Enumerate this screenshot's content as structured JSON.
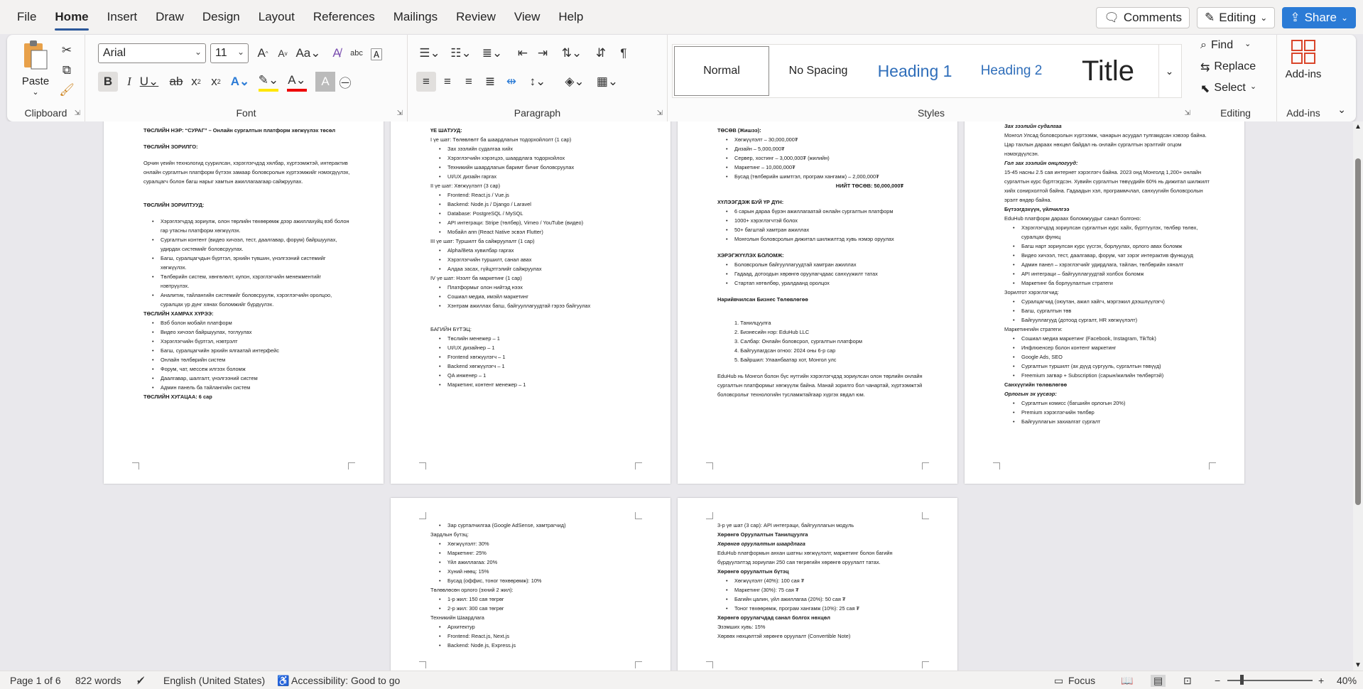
{
  "menu": {
    "tabs": [
      "File",
      "Home",
      "Insert",
      "Draw",
      "Design",
      "Layout",
      "References",
      "Mailings",
      "Review",
      "View",
      "Help"
    ],
    "comments": "Comments",
    "editing": "Editing",
    "share": "Share"
  },
  "ribbon": {
    "clipboard": {
      "paste": "Paste",
      "label": "Clipboard"
    },
    "font": {
      "name": "Arial",
      "size": "11",
      "label": "Font"
    },
    "paragraph": {
      "label": "Paragraph"
    },
    "styles": {
      "label": "Styles",
      "items": [
        "Normal",
        "No Spacing",
        "Heading 1",
        "Heading 2",
        "Title"
      ]
    },
    "editing": {
      "find": "Find",
      "replace": "Replace",
      "select": "Select",
      "label": "Editing"
    },
    "addins": {
      "button": "Add-ins",
      "label": "Add-ins"
    }
  },
  "pages": {
    "p1": [
      [
        "b",
        "ТӨСЛИЙН НЭР: “СУРАГ” – Онлайн сургалтын платформ хөгжүүлэх төсөл"
      ],
      [
        "gap",
        ""
      ],
      [
        "b",
        "ТӨСЛИЙН ЗОРИЛГО:"
      ],
      [
        "gap",
        ""
      ],
      [
        "n",
        "Орчин үеийн технологид суурилсан, хэрэглэгчдэд хялбар, хүртээмжтэй, интерактив онлайн сургалтын платформ бүтээх замаар боловсролын хүртээмжийг нэмэгдүүлэх, суралцагч болон багш нарыг хамтын ажиллагаагаар сайжруулах."
      ],
      [
        "gap",
        ""
      ],
      [
        "gap",
        ""
      ],
      [
        "b",
        "ТӨСЛИЙН ЗОРИЛТУУД:"
      ],
      [
        "gap",
        ""
      ],
      [
        "li",
        "Хэрэглэгчдэд зориулж, олон төрлийн төхөөрөмж дээр ажиллахуйц вэб болон гар утасны платформ хөгжүүлэх."
      ],
      [
        "li",
        "Сургалтын контент (видео хичээл, тест, даалгавар, форум) байршуулах, удирдах системийг боловсруулах."
      ],
      [
        "li",
        "Багш, суралцагчдын бүртгэл, эрхийн түвшин, үнэлгээний системийг хөгжүүлэх."
      ],
      [
        "li",
        "Төлбөрийн систем, хөнгөлөлт, купон, хэрэглэгчийн менежментийг нэвтрүүлэх."
      ],
      [
        "li",
        "Аналитик, тайлангийн системийг боловсруулж, хэрэглэгчийн оролцоо, суралцах үр дүнг хянах боломжийг бүрдүүлэх."
      ],
      [
        "b",
        "ТӨСЛИЙН ХАМРАХ ХҮРЭЭ:"
      ],
      [
        "li",
        "Вэб болон мобайл платформ"
      ],
      [
        "li",
        "Видео хичээл байршуулах, тоглуулах"
      ],
      [
        "li",
        "Хэрэглэгчийн бүртгэл, нэвтрэлт"
      ],
      [
        "li",
        "Багш, суралцагчийн эрхийн ялгаатай интерфейс"
      ],
      [
        "li",
        "Онлайн төлбөрийн систем"
      ],
      [
        "li",
        "Форум, чат, мессеж илгээх боломж"
      ],
      [
        "li",
        "Даалгавар, шалгалт, үнэлгээний систем"
      ],
      [
        "li",
        "Админ панель ба тайлангийн систем"
      ],
      [
        "b",
        "ТӨСЛИЙН ХУГАЦАА: 6 сар"
      ]
    ],
    "p2": [
      [
        "b",
        "ҮЕ ШАТУУД:"
      ],
      [
        "n",
        "I үе шат: Төлөвлөлт ба шаардлагын тодорхойлолт (1 сар)"
      ],
      [
        "li",
        "Зах зээлийн судалгаа хийх"
      ],
      [
        "li",
        "Хэрэглэгчийн хэрэгцээ, шаардлага тодорхойлох"
      ],
      [
        "li",
        "Техникийн шаардлагын баримт бичиг боловсруулах"
      ],
      [
        "li",
        "UI/UX дизайн гаргах"
      ],
      [
        "n",
        "II үе шат: Хөгжүүлэлт (3 сар)"
      ],
      [
        "li",
        "Frontend: React.js / Vue.js"
      ],
      [
        "li",
        "Backend: Node.js / Django / Laravel"
      ],
      [
        "li",
        "Database: PostgreSQL / MySQL"
      ],
      [
        "li",
        "API интеграци: Stripe (төлбөр), Vimeo / YouTube (видео)"
      ],
      [
        "li",
        "Мобайл апп (React Native эсвэл Flutter)"
      ],
      [
        "n",
        "III үе шат: Туршилт ба сайжруулалт (1 сар)"
      ],
      [
        "li",
        "Alpha/Beta хувилбар гаргах"
      ],
      [
        "li",
        "Хэрэглэгчийн туршилт, санал авах"
      ],
      [
        "li",
        "Алдаа засах, гүйцэтгэлийг сайжруулах"
      ],
      [
        "n",
        "IV үе шат: Нээлт ба маркетинг (1 сар)"
      ],
      [
        "li",
        "Платформыг олон нийтэд нээх"
      ],
      [
        "li",
        "Сошиал медиа, имэйл маркетинг"
      ],
      [
        "li",
        "Хэнтрам ажиллах багш, байгууллагуудтай гэрээ байгуулах"
      ],
      [
        "gap",
        ""
      ],
      [
        "gap",
        ""
      ],
      [
        "n",
        "БАГИЙН БҮТЭЦ:"
      ],
      [
        "li",
        "Төслийн менежер – 1"
      ],
      [
        "li",
        "UI/UX дизайнер – 1"
      ],
      [
        "li",
        "Frontend хөгжүүлэгч – 1"
      ],
      [
        "li",
        "Backend хөгжүүлэгч – 1"
      ],
      [
        "li",
        "QA инженер – 1"
      ],
      [
        "li",
        "Маркетинг, контент менежер – 1"
      ]
    ],
    "p3": [
      [
        "b",
        "ТӨСӨВ (Жишээ):"
      ],
      [
        "li",
        "Хөгжүүлэлт – 30,000,000₮"
      ],
      [
        "li",
        "Дизайн – 5,000,000₮"
      ],
      [
        "li",
        "Сервер, хостинг – 3,000,000₮ (жилийн)"
      ],
      [
        "li",
        "Маркетинг – 10,000,000₮"
      ],
      [
        "li",
        "Бусад (төлбөрийн шимтгэл, програм хангамж) – 2,000,000₮"
      ],
      [
        "c",
        "НИЙТ ТӨСӨВ: 50,000,000₮"
      ],
      [
        "gap",
        ""
      ],
      [
        "b",
        "ХҮЛЭЭГДЭЖ БУЙ ҮР ДҮН:"
      ],
      [
        "li",
        "6 сарын дараа бүрэн ажиллагаатай онлайн сургалтын платформ"
      ],
      [
        "li",
        "1000+ хэрэглэгчтэй болох"
      ],
      [
        "li",
        "50+ багштай хамтран ажиллах"
      ],
      [
        "li",
        "Монголын боловсролын дижитал шилжилтэд хувь нэмэр оруулах"
      ],
      [
        "gap",
        ""
      ],
      [
        "b",
        "ХЭРЭГЖҮҮЛЭХ БОЛОМЖ:"
      ],
      [
        "li",
        "Боловсролын байгууллагуудтай хамтран ажиллах"
      ],
      [
        "li",
        "Гадаад, дотоодын хөрөнгө оруулагчдаас санхүүжилт татах"
      ],
      [
        "li",
        "Стартап хөтөлбөр, уралдаанд оролцох"
      ],
      [
        "gap",
        ""
      ],
      [
        "b",
        "Нарийвчилсан Бизнес Төлөвлөгөө"
      ],
      [
        "gap",
        ""
      ],
      [
        "gap",
        ""
      ],
      [
        "ol",
        "1.  Танилцуулга"
      ],
      [
        "ol",
        "2.  Бизнесийн нэр: EduHub LLC"
      ],
      [
        "ol",
        "3.  Салбар: Онлайн боловсрол, сургалтын платформ"
      ],
      [
        "ol",
        "4.  Байгуулагдсан огноо: 2024 оны 6-р сар"
      ],
      [
        "ol",
        "5.  Байршил: Улаанбаатар хот, Монгол улс"
      ],
      [
        "gap",
        ""
      ],
      [
        "n",
        "    EduHub нь Монгол болон бүс нутгийн хэрэглэгчдэд зориулсан олон төрлийн онлайн сургалтын платформыг хөгжүүлж байна. Манай зорилго бол чанартай, хүртээмжтэй боловсролыг технологийн тусламжтайгаар хүргэх явдал юм."
      ]
    ],
    "p4": [
      [
        "bi",
        "Зах зээлийн судалгаа"
      ],
      [
        "n",
        "Монгол Улсад боловсролын хүртээмж, чанарын асуудал тулгамдсан хэвээр байна. Цар тахлын дараах нөхцөл байдал нь онлайн сургалтын эрэлтийг огцом нэмэгдүүлсэн."
      ],
      [
        "bi",
        "Гол зах зээлийн онцлогууд:"
      ],
      [
        "n",
        "15-45 насны 2.5 сая интернет хэрэглэгч байна. 2023 онд Монголд 1,200+ онлайн сургалтын курс бүртгэгдсэн. Хувийн сургалтын төвүүдийн 60% нь дижитал шилжилт хийх сонирхолтой байна. Гадаадын хэл, программчлал, санхүүгийн боловсролын эрэлт өндөр байна."
      ],
      [
        "b",
        "Бүтээгдэхүүн, үйлчилгээ"
      ],
      [
        "n",
        "EduHub платформ дараах боломжуудыг санал болгоно:"
      ],
      [
        "li",
        "Хэрэглэгчдэд зориулсан сургалтын курс хайх, бүртгүүлэх, төлбөр төлөх, суралцах функц"
      ],
      [
        "li",
        "Багш нарт зориулсан курс үүсгэх, борлуулах, орлого авах боломж"
      ],
      [
        "li",
        "Видео хичээл, тест, даалгавар, форум, чат зэрэг интерактив функцууд"
      ],
      [
        "li",
        "Админ панел – хэрэглэгчийг удирдлага, тайлан, төлбөрийн хяналт"
      ],
      [
        "li",
        "API интеграци – байгууллагуудтай холбох боломж"
      ],
      [
        "li",
        "Маркетинг ба борлуулалтын стратеги"
      ],
      [
        "n",
        "Зорилтот хэрэглэгчид:"
      ],
      [
        "li",
        "Суралцагчид (оюутан, ажил хайгч, мэргэжил дээшлүүлэгч)"
      ],
      [
        "li",
        "Багш, сургалтын төв"
      ],
      [
        "li",
        "Байгууллагууд (дотоод сургалт, HR хөгжүүлэлт)"
      ],
      [
        "n",
        "Маркетингийн стратеги:"
      ],
      [
        "li",
        "Сошиал медиа маркетинг (Facebook, Instagram, TikTok)"
      ],
      [
        "li",
        "Инфлюенсер болон контент маркетинг"
      ],
      [
        "li",
        "Google Ads, SEO"
      ],
      [
        "li",
        "Сургалтын туршилт (ах дүүд сургууль, сургалтын төвүүд)"
      ],
      [
        "li",
        "Freemium загвар + Subscription (сарын/жилийн төлбөртэй)"
      ],
      [
        "b",
        "Санхүүгийн төлөвлөгөө"
      ],
      [
        "bi",
        "Орлогын эх үүсвэр:"
      ],
      [
        "li",
        "Сургалтын комисс (багшийн орлогын 20%)"
      ],
      [
        "li",
        "Premium хэрэглэгчийн төлбөр"
      ],
      [
        "li",
        "Байгууллагын захиалгат сургалт"
      ]
    ],
    "p5": [
      [
        "li",
        "Зар сурталчилгаа (Google AdSense, хамтрагчид)"
      ],
      [
        "n",
        "Зардлын бүтэц:"
      ],
      [
        "li",
        "Хөгжүүлэлт: 30%"
      ],
      [
        "li",
        "Маркетинг: 25%"
      ],
      [
        "li",
        "Үйл ажиллагаа: 20%"
      ],
      [
        "li",
        "Хүний нөөц: 15%"
      ],
      [
        "li",
        "Бусад (оффис, тоног төхөөрөмж): 10%"
      ],
      [
        "n",
        "Төлөвлөсөн орлого (эхний 2 жил):"
      ],
      [
        "li",
        "1-р жил: 150 сая төгрөг"
      ],
      [
        "li",
        "2-р жил: 300 сая төгрөг"
      ],
      [
        "n",
        "Техникийн Шаардлага"
      ],
      [
        "li",
        "Архитектур"
      ],
      [
        "li",
        "Frontend: React.js, Next.js"
      ],
      [
        "li",
        "Backend: Node.js, Express.js"
      ]
    ],
    "p6": [
      [
        "n",
        "3-р үе шат (3 сар): API интеграци, байгууллагын модуль"
      ],
      [
        "b",
        "Хөрөнгө Оруулалтын Танилцуулга"
      ],
      [
        "bi",
        "Хөрөнгө оруулалтын шаардлага"
      ],
      [
        "n",
        "EduHub платформын анхан шатны хөгжүүлэлт, маркетинг болон багийн бүрдүүлэлтэд зориулан 250 сая төгрөгийн хөрөнгө оруулалт татах."
      ],
      [
        "b",
        "Хөрөнгө оруулалтын бүтэц"
      ],
      [
        "li",
        "Хөгжүүлэлт (40%): 100 сая ₮"
      ],
      [
        "li",
        "Маркетинг (30%): 75 сая ₮"
      ],
      [
        "li",
        "Багийн цалин, үйл ажиллагаа (20%): 50 сая ₮"
      ],
      [
        "li",
        "Тоног төхөөрөмж, програм хангамж (10%): 25 сая ₮"
      ],
      [
        "b",
        "Хөрөнгө оруулагчдад санал болгох нөхцөл"
      ],
      [
        "n",
        "Эзэмших хувь: 15%"
      ],
      [
        "n",
        "Хөрвөх нөхцөлтэй хөрөнгө оруулалт (Convertible Note)"
      ]
    ]
  },
  "status": {
    "page": "Page 1 of 6",
    "words": "822 words",
    "language": "English (United States)",
    "accessibility": "Accessibility: Good to go",
    "focus": "Focus",
    "zoom": "40%"
  }
}
